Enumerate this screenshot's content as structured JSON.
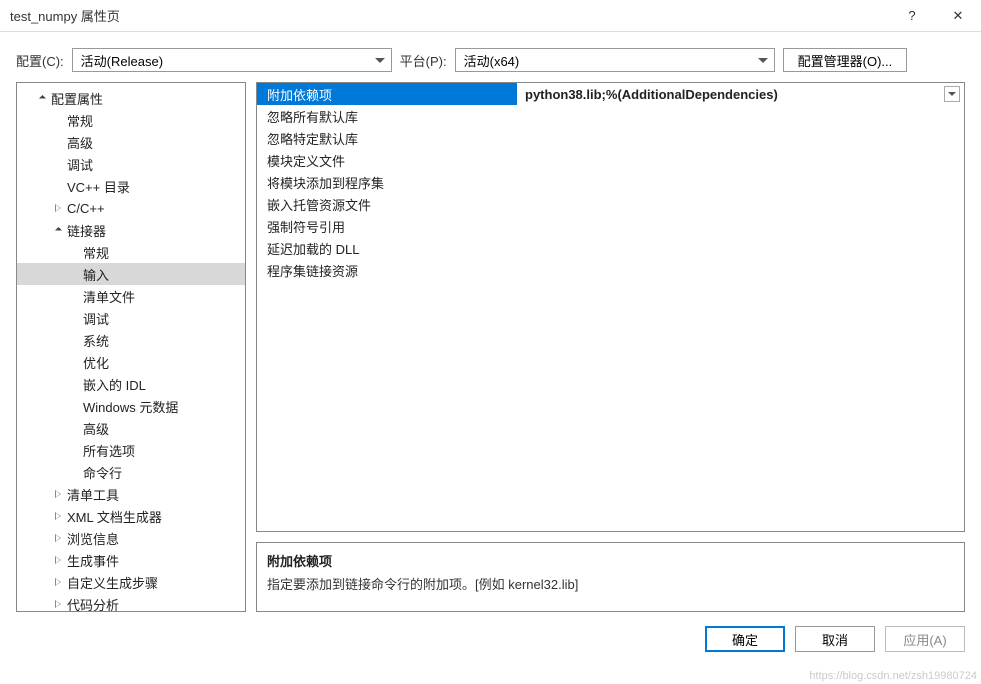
{
  "window": {
    "title": "test_numpy 属性页",
    "help_icon": "?",
    "close_icon": "✕"
  },
  "toolbar": {
    "config_label": "配置(C):",
    "config_value": "活动(Release)",
    "platform_label": "平台(P):",
    "platform_value": "活动(x64)",
    "config_manager_label": "配置管理器(O)..."
  },
  "tree": {
    "root": "配置属性",
    "items_l2": [
      "常规",
      "高级",
      "调试",
      "VC++ 目录"
    ],
    "ccpp": "C/C++",
    "linker": "链接器",
    "linker_children": [
      "常规",
      "输入",
      "清单文件",
      "调试",
      "系统",
      "优化",
      "嵌入的 IDL",
      "Windows 元数据",
      "高级",
      "所有选项",
      "命令行"
    ],
    "tail": [
      "清单工具",
      "XML 文档生成器",
      "浏览信息",
      "生成事件",
      "自定义生成步骤",
      "代码分析"
    ],
    "selected": "输入"
  },
  "grid": {
    "rows": [
      {
        "key": "附加依赖项",
        "value": "python38.lib;%(AdditionalDependencies)",
        "selected": true
      },
      {
        "key": "忽略所有默认库",
        "value": ""
      },
      {
        "key": "忽略特定默认库",
        "value": ""
      },
      {
        "key": "模块定义文件",
        "value": ""
      },
      {
        "key": "将模块添加到程序集",
        "value": ""
      },
      {
        "key": "嵌入托管资源文件",
        "value": ""
      },
      {
        "key": "强制符号引用",
        "value": ""
      },
      {
        "key": "延迟加载的 DLL",
        "value": ""
      },
      {
        "key": "程序集链接资源",
        "value": ""
      }
    ]
  },
  "description": {
    "title": "附加依赖项",
    "text": "指定要添加到链接命令行的附加项。[例如 kernel32.lib]"
  },
  "footer": {
    "ok": "确定",
    "cancel": "取消",
    "apply": "应用(A)"
  },
  "watermark": "https://blog.csdn.net/zsh19980724"
}
